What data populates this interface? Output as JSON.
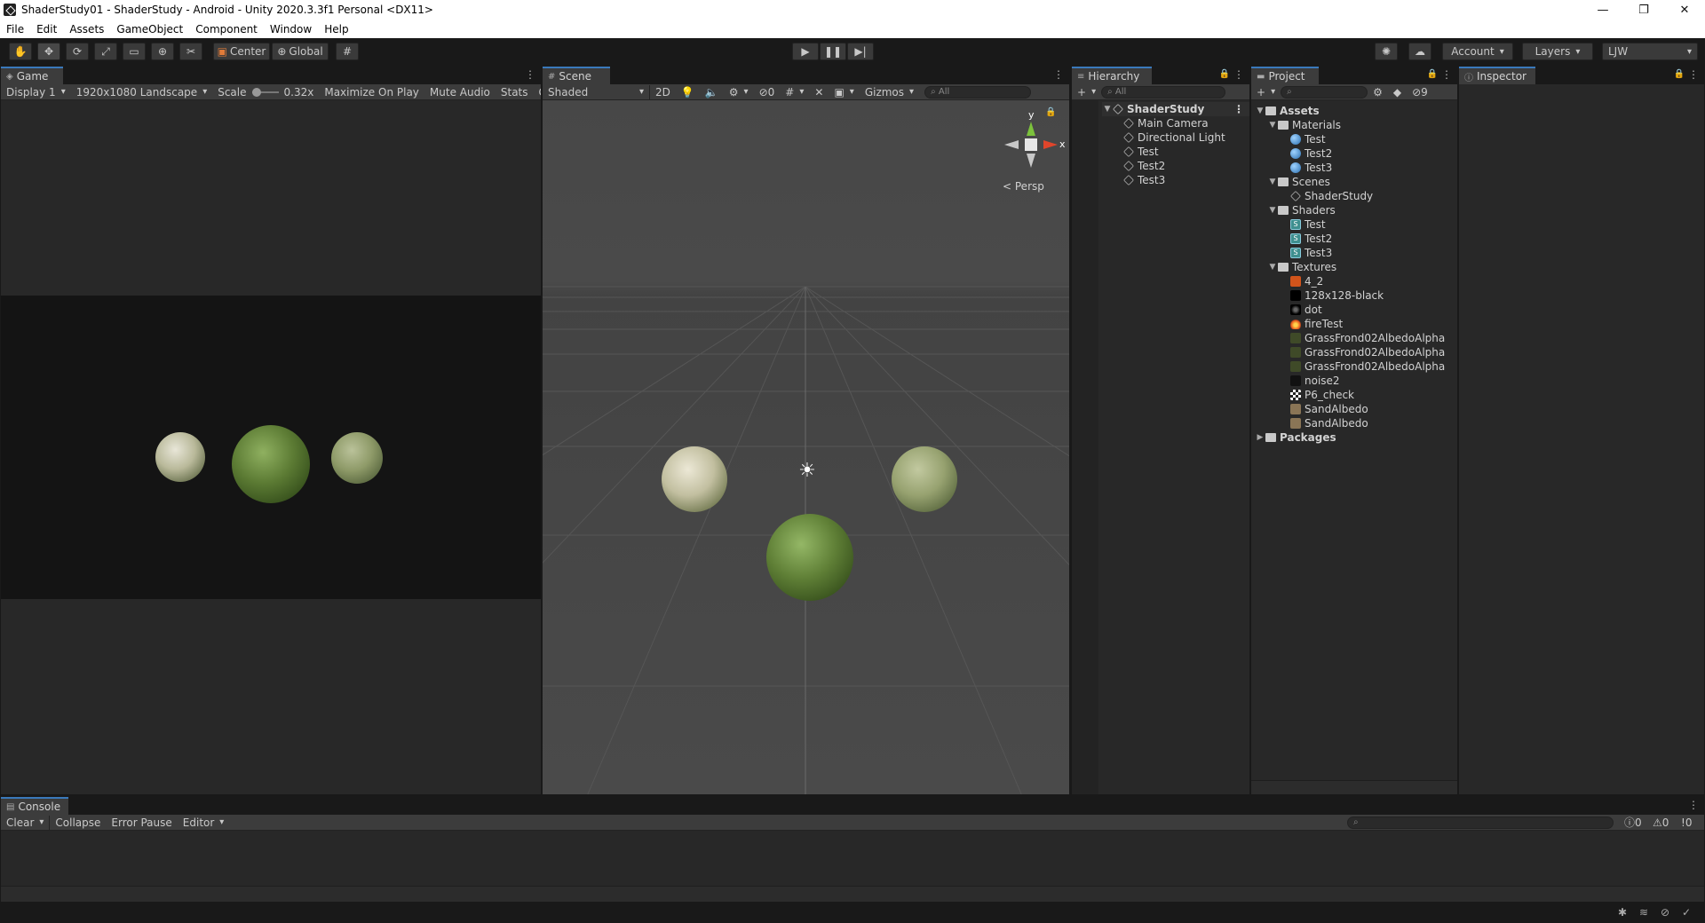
{
  "window": {
    "title": "ShaderStudy01 - ShaderStudy - Android - Unity 2020.3.3f1 Personal <DX11>",
    "minimize": "—",
    "restore": "❐",
    "close": "✕"
  },
  "menu": [
    "File",
    "Edit",
    "Assets",
    "GameObject",
    "Component",
    "Window",
    "Help"
  ],
  "toolbar": {
    "pivot": "Center",
    "space": "Global",
    "account": "Account",
    "layers": "Layers",
    "layout": "LJW"
  },
  "game": {
    "tab": "Game",
    "display": "Display 1",
    "resolution": "1920x1080 Landscape",
    "scale_label": "Scale",
    "scale_value": "0.32x",
    "maximize": "Maximize On Play",
    "mute": "Mute Audio",
    "stats": "Stats",
    "gizmos": "Giz"
  },
  "scene": {
    "tab": "Scene",
    "shading": "Shaded",
    "mode_2d": "2D",
    "hidden_count": "0",
    "gizmos": "Gizmos",
    "search_placeholder": "All",
    "persp": "Persp",
    "axis_y": "y",
    "axis_x": "x"
  },
  "hierarchy": {
    "tab": "Hierarchy",
    "search_placeholder": "All",
    "scene_name": "ShaderStudy",
    "items": [
      "Main Camera",
      "Directional Light",
      "Test",
      "Test2",
      "Test3"
    ]
  },
  "project": {
    "tab": "Project",
    "hidden_count": "9",
    "root": "Assets",
    "folders": [
      {
        "name": "Materials",
        "items": [
          "Test",
          "Test2",
          "Test3"
        ]
      },
      {
        "name": "Scenes",
        "items": [
          "ShaderStudy"
        ]
      },
      {
        "name": "Shaders",
        "items": [
          "Test",
          "Test2",
          "Test3"
        ]
      },
      {
        "name": "Textures",
        "items": [
          "4_2",
          "128x128-black",
          "dot",
          "fireTest",
          "GrassFrond02AlbedoAlpha",
          "GrassFrond02AlbedoAlpha",
          "GrassFrond02AlbedoAlpha",
          "noise2",
          "P6_check",
          "SandAlbedo",
          "SandAlbedo"
        ]
      }
    ],
    "packages": "Packages"
  },
  "inspector": {
    "tab": "Inspector"
  },
  "console": {
    "tab": "Console",
    "clear": "Clear",
    "collapse": "Collapse",
    "error_pause": "Error Pause",
    "editor": "Editor",
    "log_count": "0",
    "warn_count": "0",
    "error_count": "0"
  },
  "colors": {
    "tab_accent": "#3a79bb",
    "panel_bg": "#282828",
    "scene_bg": "#474747"
  }
}
